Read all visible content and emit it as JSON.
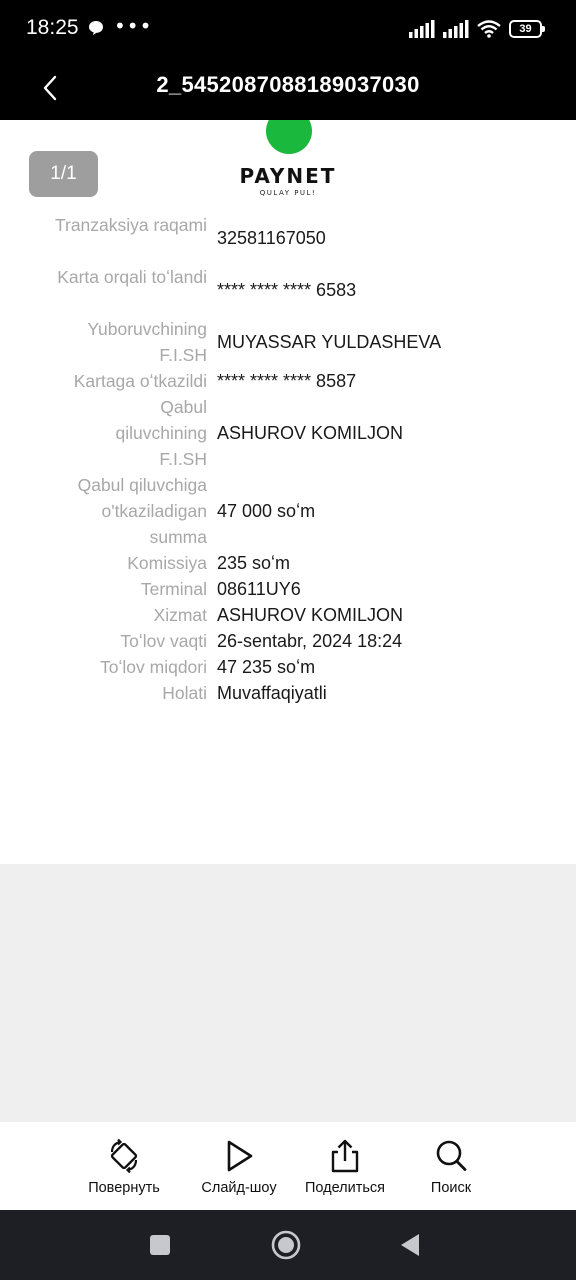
{
  "status_bar": {
    "time": "18:25",
    "extra": "•••",
    "battery": "39",
    "icons": [
      "chat-icon",
      "signal-icon",
      "signal-icon",
      "wifi-icon",
      "battery-icon"
    ]
  },
  "header": {
    "title": "2_5452087088189037030",
    "back_icon": "chevron-left-icon"
  },
  "viewer": {
    "page_counter": "1/1"
  },
  "receipt": {
    "brand": "PAYNET",
    "tagline": "QULAY PUL!",
    "brand_color": "#1ab83d",
    "rows": [
      {
        "label": "Tranzaksiya raqami",
        "value": "32581167050"
      },
      {
        "label": "Karta orqali toʻlandi",
        "value": "**** **** **** 6583"
      },
      {
        "label": "Yuboruvchining F.I.SH",
        "value": "MUYASSAR YULDASHEVA"
      },
      {
        "label": "Kartaga oʻtkazildi",
        "value": "**** **** **** 8587"
      },
      {
        "label": "Qabul qiluvchining F.I.SH",
        "value": "ASHUROV KOMILJON"
      },
      {
        "label": "Qabul qiluvchiga o'tkaziladigan summa",
        "value": "47 000 soʻm"
      },
      {
        "label": "Komissiya",
        "value": "235 soʻm"
      },
      {
        "label": "Terminal",
        "value": "08611UY6"
      },
      {
        "label": "Xizmat",
        "value": "ASHUROV KOMILJON"
      },
      {
        "label": "Toʻlov vaqti",
        "value": "26-sentabr, 2024 18:24"
      },
      {
        "label": "Toʻlov miqdori",
        "value": "47 235 soʻm"
      },
      {
        "label": "Holati",
        "value": "Muvaffaqiyatli"
      }
    ]
  },
  "toolbar": {
    "rotate": {
      "label": "Повернуть",
      "icon": "rotate-icon"
    },
    "slideshow": {
      "label": "Слайд-шоу",
      "icon": "play-icon"
    },
    "share": {
      "label": "Поделиться",
      "icon": "share-icon"
    },
    "search": {
      "label": "Поиск",
      "icon": "search-icon"
    }
  },
  "nav": {
    "icons": [
      "square-icon",
      "home-circle-icon",
      "back-triangle-icon"
    ]
  }
}
